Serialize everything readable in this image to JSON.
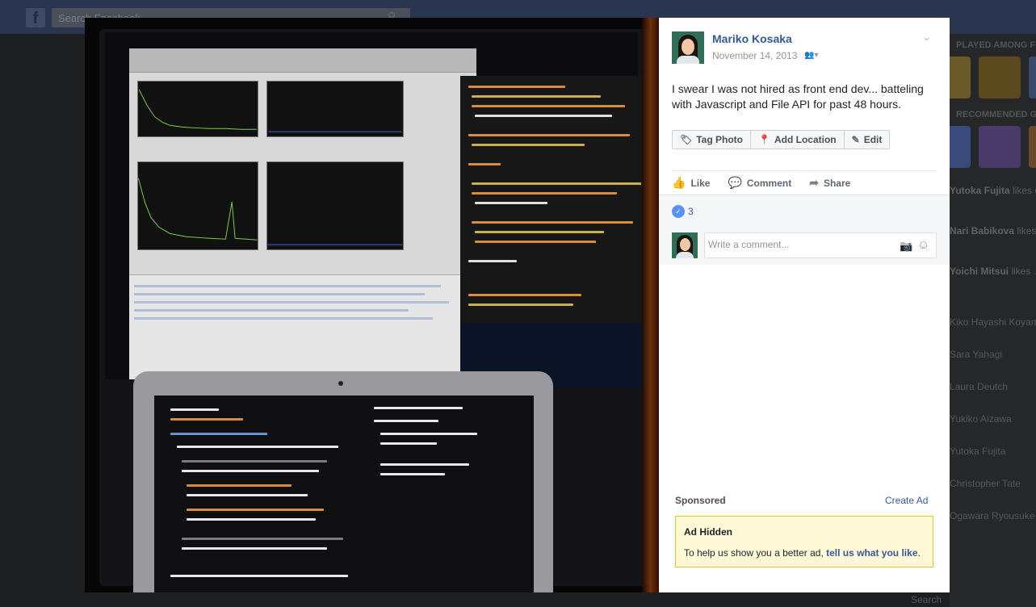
{
  "background": {
    "search_placeholder": "Search Facebook",
    "right_headings": [
      "PLAYED AMONG FRIENDS",
      "RECOMMENDED GAMES"
    ],
    "ticker": [
      {
        "name": "Yutoka Fujita",
        "action": "likes on ...'s photo."
      },
      {
        "name": "Nari Babikova",
        "action": "likes ...kekta's photo."
      },
      {
        "name": "Yoichi Mitsui",
        "action": "likes ...ijkawa's post."
      }
    ],
    "friends": [
      "Kiko Hayashi Koyama",
      "Sara Yahagi",
      "Laura Deutch",
      "Yukiko Aizawa",
      "Yutoka Fujita",
      "Christopher Tate",
      "Ogawara Ryousuke"
    ],
    "bottom_search": "Search"
  },
  "post": {
    "author": "Mariko Kosaka",
    "date": "November 14, 2013",
    "text": "I swear I was not hired as front end dev... batteling with Javascript and File API for past 48 hours."
  },
  "photo_actions": {
    "tag_photo": "Tag Photo",
    "add_location": "Add Location",
    "edit": "Edit"
  },
  "reactions": {
    "like": "Like",
    "comment": "Comment",
    "share": "Share"
  },
  "feedback": {
    "like_count": "3",
    "comment_placeholder": "Write a comment..."
  },
  "ads": {
    "sponsored_label": "Sponsored",
    "create_ad": "Create Ad",
    "hidden_title": "Ad Hidden",
    "hidden_text": "To help us show you a better ad,",
    "hidden_link": "tell us what you like",
    "hidden_suffix": "."
  },
  "icons": {
    "facebook_logo": "f",
    "search": "⚲",
    "chevron_down": "⌄",
    "audience": "👥▾",
    "tag": "🏷",
    "location_pin": "📍",
    "pencil": "✎",
    "thumbs_up": "👍",
    "comment_bubble": "💬",
    "share_arrow": "➦",
    "camera": "📷",
    "smiley": "☺"
  },
  "colors": {
    "link_blue": "#365899",
    "like_blue": "#5890ff",
    "ad_yellow": "#fff9d7"
  }
}
